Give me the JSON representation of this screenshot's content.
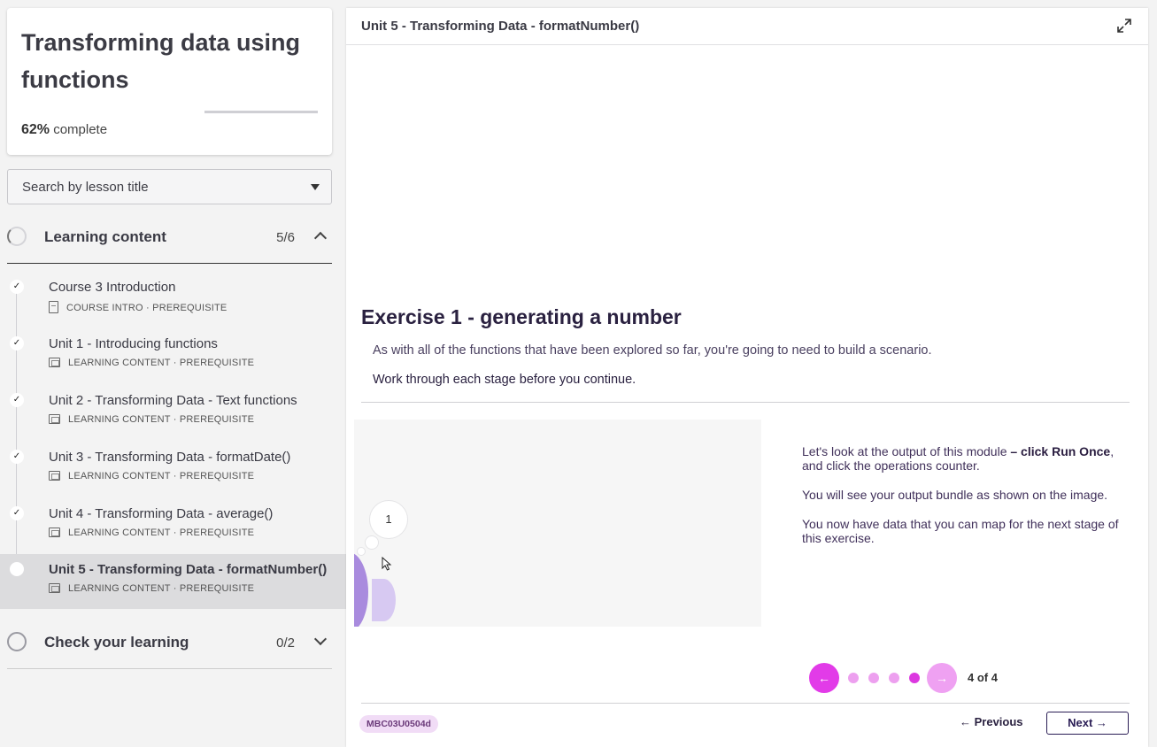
{
  "sidebar": {
    "course_title": "Transforming data using functions",
    "progress_percent": 62,
    "progress_percent_label": "62%",
    "progress_suffix": "complete",
    "search_placeholder": "Search by lesson title",
    "sections": [
      {
        "title": "Learning content",
        "count": "5/6",
        "expanded": true
      },
      {
        "title": "Check your learning",
        "count": "0/2",
        "expanded": false
      }
    ],
    "lessons": [
      {
        "title": "Course 3 Introduction",
        "type": "COURSE INTRO",
        "tag": "PREREQUISITE",
        "done": true
      },
      {
        "title": "Unit 1 - Introducing functions",
        "type": "LEARNING CONTENT",
        "tag": "PREREQUISITE",
        "done": true
      },
      {
        "title": "Unit 2 - Transforming Data - Text functions",
        "type": "LEARNING CONTENT",
        "tag": "PREREQUISITE",
        "done": true
      },
      {
        "title": "Unit 3 - Transforming Data - formatDate()",
        "type": "LEARNING CONTENT",
        "tag": "PREREQUISITE",
        "done": true
      },
      {
        "title": "Unit 4 - Transforming Data - average()",
        "type": "LEARNING CONTENT",
        "tag": "PREREQUISITE",
        "done": true
      },
      {
        "title": "Unit 5 - Transforming Data - formatNumber()",
        "type": "LEARNING CONTENT",
        "tag": "PREREQUISITE",
        "done": false,
        "active": true
      }
    ],
    "check_glyph": "✓",
    "meta_separator": "·"
  },
  "main": {
    "header_title": "Unit 5 - Transforming Data - formatNumber()",
    "exercise_title": "Exercise 1 - generating a number",
    "intro": "As with all of the functions that have been explored so far, you're going to need to build a scenario.",
    "instruction": "Work through each stage before you continue",
    "instruction_end": ".",
    "media_bubble_number": "1",
    "media_text": {
      "p1_a": "Let's look at the output of this module ",
      "p1_bold": "– click Run Once",
      "p1_b": ", and click the operations counter.",
      "p2": "You will see your output bundle as shown on the image.",
      "p3": "You now have data that you can map for the next stage of this exercise."
    },
    "carousel": {
      "prev_glyph": "←",
      "next_glyph": "→",
      "counter": "4 of 4",
      "current": 4,
      "total": 4
    },
    "code_badge": "MBC03U0504d",
    "prev_label": "← Previous",
    "next_label": "Next →"
  },
  "colors": {
    "accent_magenta": "#e23be8",
    "accent_magenta_light": "#efa1f2",
    "dark_purple": "#2a1d55",
    "badge_bg": "#f1dcf6"
  }
}
